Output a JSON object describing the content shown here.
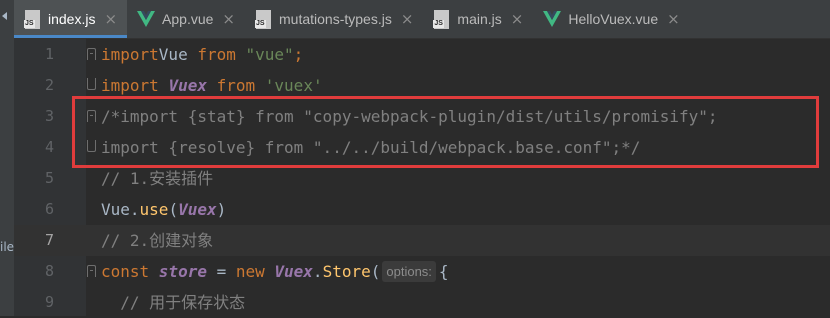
{
  "side_panel": {
    "label": "ile"
  },
  "tabs": [
    {
      "label": "index.js",
      "icon": "js-file-icon",
      "active": true
    },
    {
      "label": "App.vue",
      "icon": "vue-file-icon",
      "active": false
    },
    {
      "label": "mutations-types.js",
      "icon": "js-file-icon",
      "active": false
    },
    {
      "label": "main.js",
      "icon": "js-file-icon",
      "active": false
    },
    {
      "label": "HelloVuex.vue",
      "icon": "vue-file-icon",
      "active": false
    }
  ],
  "tab_close_glyph": "×",
  "js_badge": "JS",
  "editor": {
    "current_line": 7,
    "lines": [
      {
        "n": "1",
        "tokens": [
          [
            "kw",
            "import"
          ],
          [
            "",
            "Vue "
          ],
          [
            "kw",
            "from "
          ],
          [
            "str",
            "\"vue\""
          ],
          [
            "kw",
            ";"
          ]
        ]
      },
      {
        "n": "2",
        "tokens": [
          [
            "kw",
            "import "
          ],
          [
            "ital",
            "Vuex "
          ],
          [
            "kw",
            "from "
          ],
          [
            "str",
            "'vuex'"
          ]
        ]
      },
      {
        "n": "3",
        "tokens": [
          [
            "cmt",
            "/*import {stat} from \"copy-webpack-plugin/dist/utils/promisify\";"
          ]
        ]
      },
      {
        "n": "4",
        "tokens": [
          [
            "cmt",
            "import {resolve} from \"../../build/webpack.base.conf\";*/"
          ]
        ]
      },
      {
        "n": "5",
        "tokens": [
          [
            "cmt",
            "// 1.安装插件"
          ]
        ]
      },
      {
        "n": "6",
        "tokens": [
          [
            "",
            "Vue."
          ],
          [
            "fn",
            "use"
          ],
          [
            "",
            "("
          ],
          [
            "ital",
            "Vuex"
          ],
          [
            "",
            ")"
          ]
        ]
      },
      {
        "n": "7",
        "tokens": [
          [
            "cmt",
            "// 2.创建对象"
          ]
        ]
      },
      {
        "n": "8",
        "tokens": [
          [
            "kw",
            "const "
          ],
          [
            "ital",
            "store "
          ],
          [
            "",
            "= "
          ],
          [
            "kw",
            "new "
          ],
          [
            "ital",
            "Vuex"
          ],
          [
            "",
            "."
          ],
          [
            "fn",
            "Store"
          ],
          [
            "",
            "("
          ],
          [
            "hint",
            "options:"
          ],
          [
            "",
            "{"
          ]
        ]
      },
      {
        "n": "9",
        "tokens": [
          [
            "",
            "  "
          ],
          [
            "cmt",
            "// 用于保存状态"
          ]
        ]
      }
    ]
  },
  "colors": {
    "keyword": "#cc7832",
    "string": "#6a8759",
    "comment": "#808080",
    "italic_class": "#9876aa",
    "function": "#ffc66d",
    "highlight_border": "#e03c3c",
    "active_tab_underline": "#4a88c7"
  }
}
